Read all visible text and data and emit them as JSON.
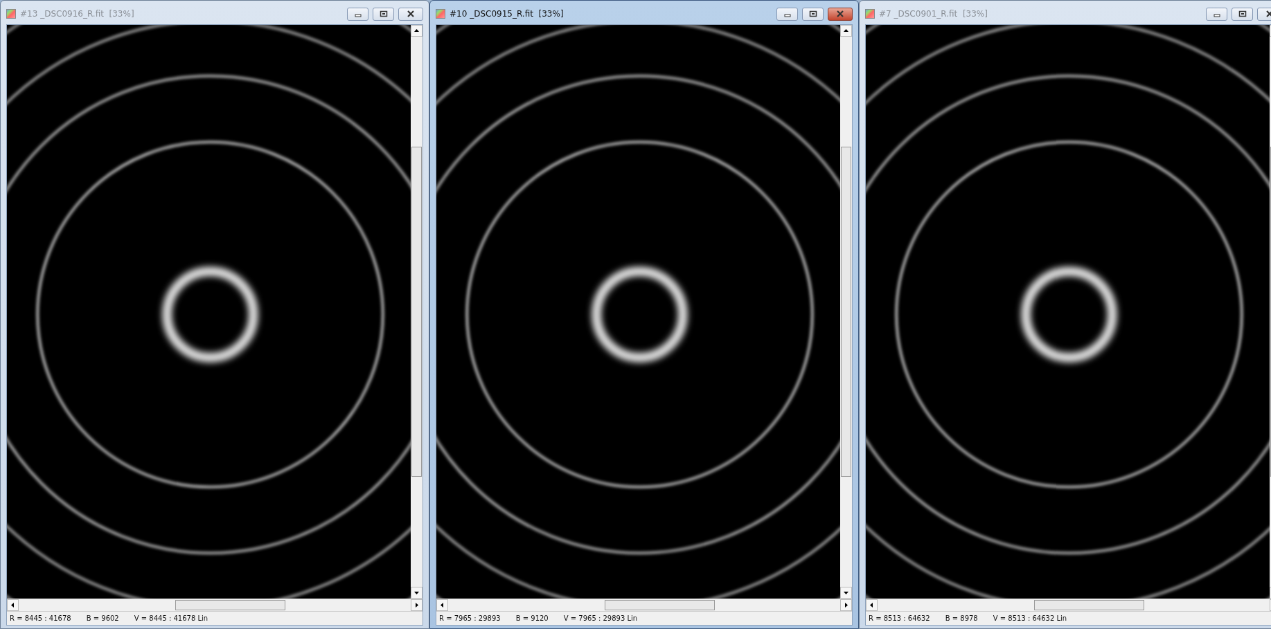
{
  "windows": [
    {
      "title": "#13 _DSC0916_R.fit  [33%]",
      "selected": false,
      "status": {
        "r": "R = 8445 : 41678",
        "b": "B = 9602",
        "v": "V = 8445 : 41678 Lin"
      }
    },
    {
      "title": "#10 _DSC0915_R.fit  [33%]",
      "selected": true,
      "status": {
        "r": "R = 7965 : 29893",
        "b": "B = 9120",
        "v": "V = 7965 : 29893 Lin"
      }
    },
    {
      "title": "#7 _DSC0901_R.fit  [33%]",
      "selected": false,
      "status": {
        "r": "R = 8513 : 64632",
        "b": "B = 8978",
        "v": "V = 8513 : 64632 Lin"
      }
    }
  ]
}
